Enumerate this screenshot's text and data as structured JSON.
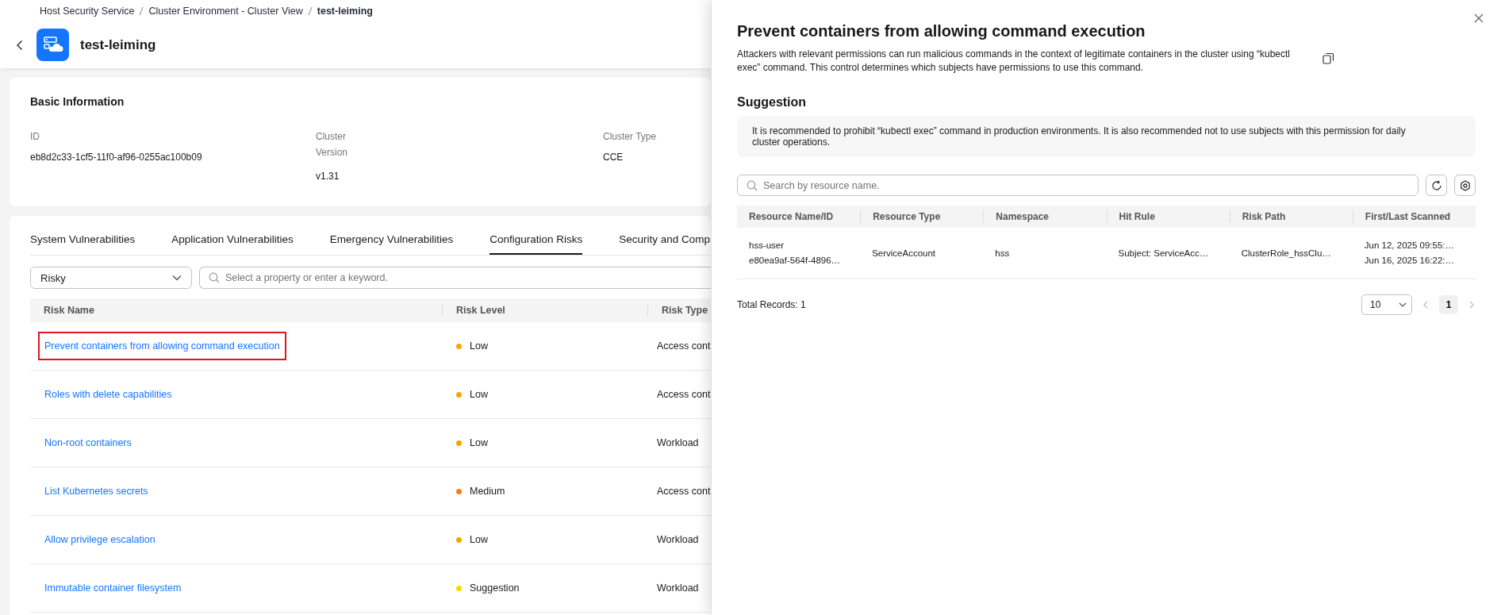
{
  "breadcrumb": [
    {
      "label": "Host Security Service",
      "current": false
    },
    {
      "label": "Cluster Environment - Cluster View",
      "current": false
    },
    {
      "label": "test-leiming",
      "current": true
    }
  ],
  "page_title": "test-leiming",
  "basic_information": {
    "title": "Basic Information",
    "fields": [
      {
        "label": "ID",
        "value": "eb8d2c33-1cf5-11f0-af96-0255ac100b09"
      },
      {
        "label": "Cluster Version",
        "value": "v1.31"
      },
      {
        "label": "Cluster Type",
        "value": "CCE"
      }
    ]
  },
  "tabs": [
    {
      "label": "System Vulnerabilities",
      "selected": false
    },
    {
      "label": "Application Vulnerabilities",
      "selected": false
    },
    {
      "label": "Emergency Vulnerabilities",
      "selected": false
    },
    {
      "label": "Configuration Risks",
      "selected": true
    },
    {
      "label": "Security and Comp",
      "selected": false
    }
  ],
  "filter": {
    "value": "Risky"
  },
  "search": {
    "placeholder": "Select a property or enter a keyword."
  },
  "risk_table": {
    "columns": [
      "Risk Name",
      "Risk Level",
      "Risk Type"
    ],
    "rows": [
      {
        "name": "Prevent containers from allowing command execution",
        "level": "Low",
        "color": "#f7a600",
        "type": "Access cont",
        "highlighted": true
      },
      {
        "name": "Roles with delete capabilities",
        "level": "Low",
        "color": "#f7a600",
        "type": "Access cont",
        "highlighted": false
      },
      {
        "name": "Non-root containers",
        "level": "Low",
        "color": "#f7a600",
        "type": "Workload",
        "highlighted": false
      },
      {
        "name": "List Kubernetes secrets",
        "level": "Medium",
        "color": "#ff7a14",
        "type": "Access cont",
        "highlighted": false
      },
      {
        "name": "Allow privilege escalation",
        "level": "Low",
        "color": "#f7a600",
        "type": "Workload",
        "highlighted": false
      },
      {
        "name": "Immutable container filesystem",
        "level": "Suggestion",
        "color": "#f5dc00",
        "type": "Workload",
        "highlighted": false
      }
    ]
  },
  "drawer": {
    "title": "Prevent containers from allowing command execution",
    "description": "Attackers with relevant permissions can run malicious commands in the context of legitimate containers in the cluster using “kubectl exec” command. This control determines which subjects have permissions to use this command.",
    "suggestion_title": "Suggestion",
    "suggestion": "It is recommended to prohibit “kubectl exec” command in production environments. It is also recommended not to use subjects with this permission for daily cluster operations.",
    "search": {
      "placeholder": "Search by resource name."
    },
    "table": {
      "columns": [
        "Resource Name/ID",
        "Resource Type",
        "Namespace",
        "Hit Rule",
        "Risk Path",
        "First/Last Scanned"
      ],
      "rows": [
        {
          "cells": [
            [
              "hss-user",
              "e80ea9af-564f-4896…"
            ],
            [
              "ServiceAccount"
            ],
            [
              "hss"
            ],
            [
              "Subject: ServiceAcc…"
            ],
            [
              "ClusterRole_hssClu…"
            ],
            [
              "Jun 12, 2025 09:55:…",
              "Jun 16, 2025 16:22:…"
            ]
          ]
        }
      ]
    },
    "total": "Total Records: 1",
    "page_size": "10",
    "pages": [
      {
        "label": "1",
        "selected": true
      }
    ]
  }
}
